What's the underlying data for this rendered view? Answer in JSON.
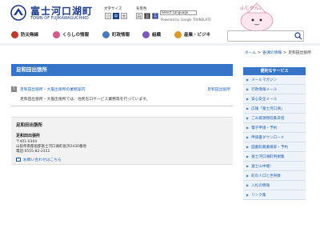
{
  "header": {
    "logo_title": "富士河口湖町",
    "logo_subtitle": "TOWN OF FUJIKAWAGUCHIKO",
    "font_size_label": "文字サイズ",
    "font_sizes": [
      "小",
      "中",
      "大"
    ],
    "bg_color_label": "背景色",
    "bg_colors": [
      "白",
      "黒",
      "青"
    ],
    "lang_select_value": "Select Language",
    "translate_credit": "Powered by Google TRANSLATE",
    "mascot_label": "ふじやん。",
    "search_icon": "search-icon"
  },
  "nav": [
    {
      "label": "防災無線",
      "icon": "radio-icon",
      "color": "#c0392b"
    },
    {
      "label": "くらしの情報",
      "icon": "house-icon",
      "color": "#d35a8a"
    },
    {
      "label": "町政情報",
      "icon": "townhall-icon",
      "color": "#4a7ab8"
    },
    {
      "label": "組織",
      "icon": "people-icon",
      "color": "#7a5ab8"
    },
    {
      "label": "産業・ビジネ",
      "icon": "industry-icon",
      "color": "#d89a2a"
    }
  ],
  "breadcrumb": {
    "home": "ホーム",
    "level1": "各課の情報",
    "current": "足和田出張所",
    "separator": ">"
  },
  "page": {
    "title": "足和田出張所"
  },
  "content": {
    "num": "1",
    "link": "足和田出張所・大嵐出張所の業務案内",
    "org": "足和田出張所",
    "desc": "足和田出張所・大嵐出張所では、住民窓口サービス業務等を行っています。"
  },
  "contact": {
    "heading": "足和田出張所",
    "name": "足和田出張所",
    "postal": "〒401-0304",
    "address": "山梨県南都留郡富士河口湖町長浜2430番地",
    "phone": "電話:0555-82-2311",
    "inquiry": "お問い合わせはこちら"
  },
  "sidebar": {
    "heading": "便利なサービス",
    "items": [
      "メールマガジン",
      "行政情報メール",
      "安心安全メール",
      "広報「富士河口湖」",
      "ごみ資源物収集日程",
      "電子申請・予約",
      "申請書ダウンロード",
      "図書館蔵書検索・予約",
      "富士河口湖町例規集",
      "富士山中継!",
      "町の人口と世帯数",
      "入札の情報",
      "リンク集"
    ]
  }
}
